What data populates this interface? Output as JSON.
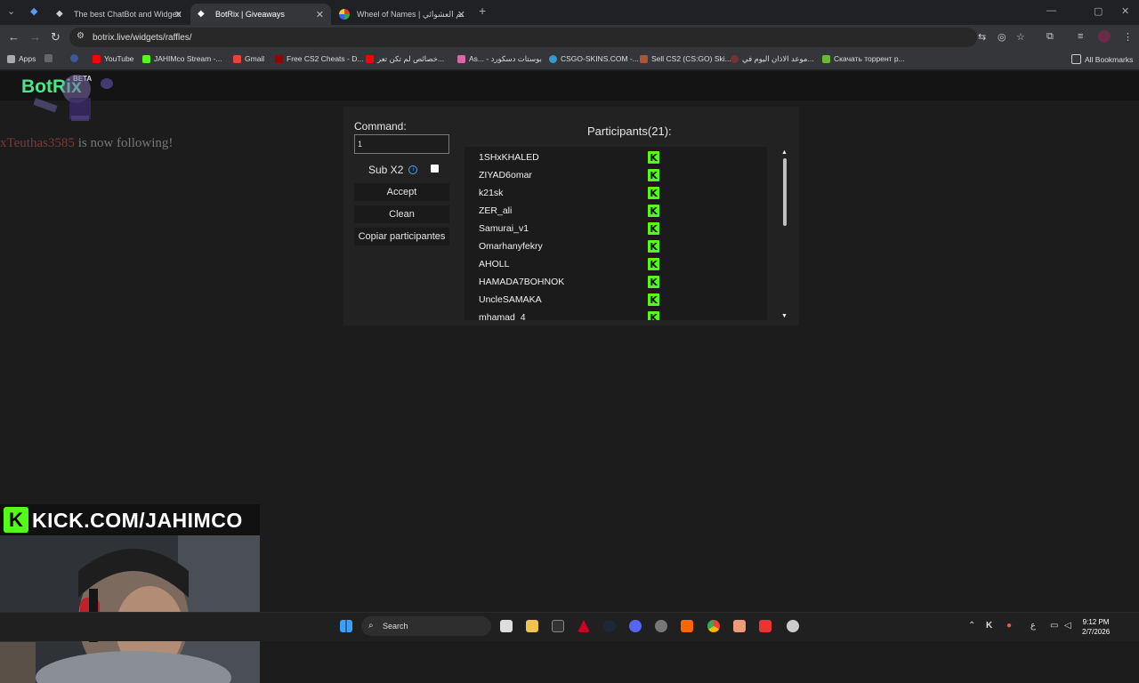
{
  "browser": {
    "tabs": [
      {
        "label": "The best ChatBot and Widgets",
        "active": false
      },
      {
        "label": "BotRix | Giveaways",
        "active": true
      },
      {
        "label": "Wheel of Names | سم العشوائي",
        "active": false
      }
    ],
    "url": "botrix.live/widgets/raffles/",
    "bookmarks": [
      "Apps",
      "YouTube",
      "JAHIMco Stream -...",
      "Gmail",
      "Free CS2 Cheats - D...",
      "خصائص لم تكن تعر...",
      "As... - بوستات دسكورد",
      "CSGO-SKINS.COM -...",
      "Sell CS2 (CS:GO) Ski...",
      "موعد الاذان اليوم في...",
      "Скачать торрент р...",
      "All Bookmarks"
    ]
  },
  "page": {
    "logo": "BotRix",
    "beta": "BETA",
    "follow_user": "xTeuthas3585",
    "follow_text": "is now following!",
    "command_label": "Command:",
    "command_value": "1",
    "sub_label": "Sub X2",
    "buttons": {
      "accept": "Accept",
      "clean": "Clean",
      "copy": "Copiar participantes"
    },
    "participants_title": "Participants(21):",
    "participants": [
      "1SHxKHALED",
      "ZIYAD6omar",
      "k21sk",
      "ZER_ali",
      "Samurai_v1",
      "Omarhanyfekry",
      "AHOLL",
      "HAMADA7BOHNOK",
      "UncleSAMAKA",
      "mhamad_4"
    ],
    "kick_badge": "K"
  },
  "overlay": {
    "kick_text": "KICK.COM/JAHIMCO",
    "kick_logo": "K"
  },
  "taskbar": {
    "search": "Search",
    "time": "9:12 PM",
    "date": "2/7/2026",
    "lang": "ع"
  },
  "colors": {
    "kick_green": "#53fc18",
    "botrix_green": "#4ce68a",
    "panel": "#222222",
    "list_bg": "#1b1b1b"
  }
}
